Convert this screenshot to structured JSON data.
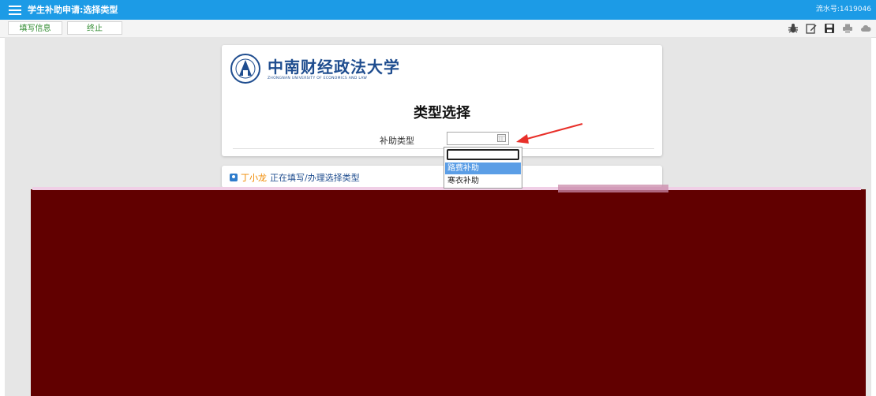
{
  "header": {
    "title": "学生补助申请:选择类型",
    "flow_no": "流水号:1419046"
  },
  "toolbar": {
    "fill_info_label": "填写信息",
    "terminate_label": "终止",
    "icons": [
      "bug-icon",
      "edit-icon",
      "save-icon",
      "print-icon",
      "cloud-icon"
    ]
  },
  "university": {
    "name_cn": "中南财经政法大学",
    "name_en": "ZHONGNAN UNIVERSITY OF ECONOMICS AND LAW"
  },
  "form": {
    "heading": "类型选择",
    "subsidy_type_label": "补助类型",
    "subsidy_type_value": "",
    "dropdown_options": [
      "路费补助",
      "寒衣补助"
    ],
    "highlighted_option_index": 0
  },
  "status": {
    "user_name": "丁小龙",
    "text": "正在填写/办理选择类型"
  },
  "colors": {
    "top_bar": "#1c9be6",
    "overlay": "#610000",
    "highlight": "#5b9ee6",
    "arrow": "#e8302a"
  }
}
